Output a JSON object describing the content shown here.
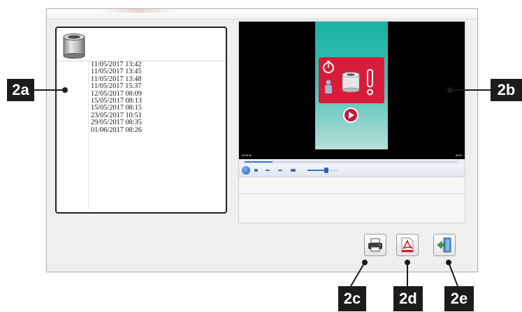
{
  "records": [
    "11/05/2017 13:42",
    "11/05/2017 13:45",
    "11/05/2017 13:48",
    "11/05/2017 15:37",
    "12/05/2017 08:09",
    "15/05/2017 08:13",
    "15/05/2017 08:15",
    "23/05/2017 10:51",
    "29/05/2017 08:35",
    "01/06/2017 08:26"
  ],
  "video": {
    "progress": 0.13,
    "volume": 0.62
  },
  "buttons": {
    "print_icon": "printer-icon",
    "pdf_icon": "pdf-icon",
    "exit_icon": "exit-door-icon"
  },
  "callouts": {
    "a": "2a",
    "b": "2b",
    "c": "2c",
    "d": "2d",
    "e": "2e"
  },
  "colors": {
    "callout_bg": "#1c1c1c",
    "warning_red": "#d71c3a",
    "video_teal": "#16b3a3"
  }
}
